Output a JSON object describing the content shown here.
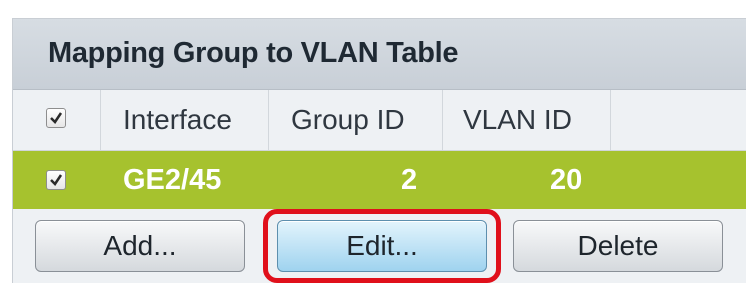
{
  "table": {
    "title": "Mapping Group to VLAN Table",
    "headers": {
      "interface": "Interface",
      "group_id": "Group ID",
      "vlan_id": "VLAN ID"
    },
    "rows": [
      {
        "selected": true,
        "interface": "GE2/45",
        "group_id": "2",
        "vlan_id": "20"
      }
    ]
  },
  "buttons": {
    "add": "Add...",
    "edit": "Edit...",
    "delete": "Delete"
  },
  "colors": {
    "selected_row": "#a6c22e",
    "highlight": "#e0101b",
    "primary_button": "#9fd3ef"
  }
}
